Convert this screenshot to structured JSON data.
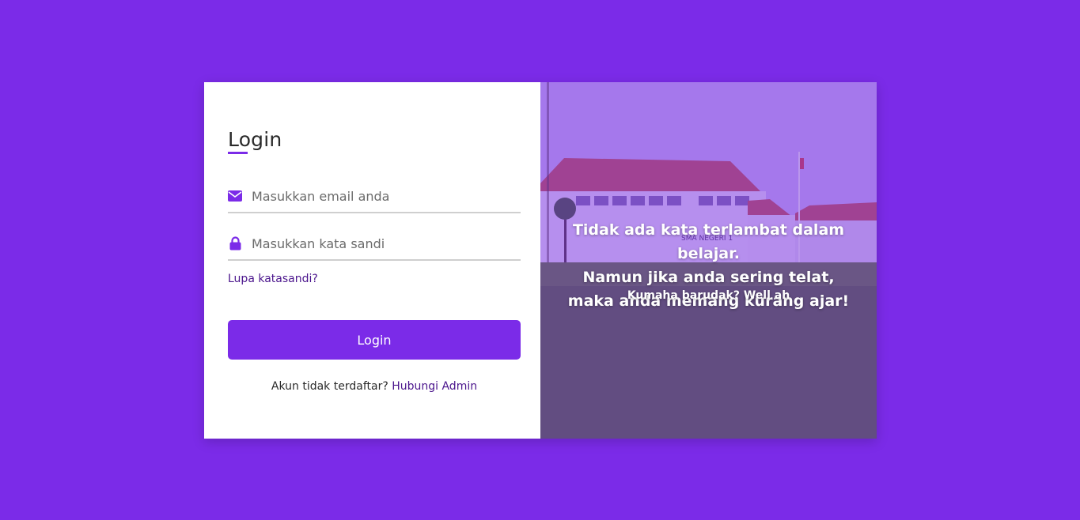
{
  "login": {
    "title": "Login",
    "email_placeholder": "Masukkan email anda",
    "password_placeholder": "Masukkan kata sandi",
    "forgot_label": "Lupa katasandi?",
    "submit_label": "Login",
    "register_text": "Akun tidak terdaftar?",
    "register_link": "Hubungi Admin",
    "email_icon": "envelope-icon",
    "password_icon": "lock-icon"
  },
  "hero": {
    "quote_line1": "Tidak ada kata terlambat dalam belajar.",
    "quote_line2": "Namun jika anda sering telat,",
    "quote_line3": "maka anda memang kurang ajar!",
    "subquote": "Kumaha barudak? Well ah",
    "school_sign": "SMA NEGERI 1"
  },
  "colors": {
    "accent": "#7b2be8",
    "link": "#4a148c",
    "background": "#7b2be8"
  }
}
